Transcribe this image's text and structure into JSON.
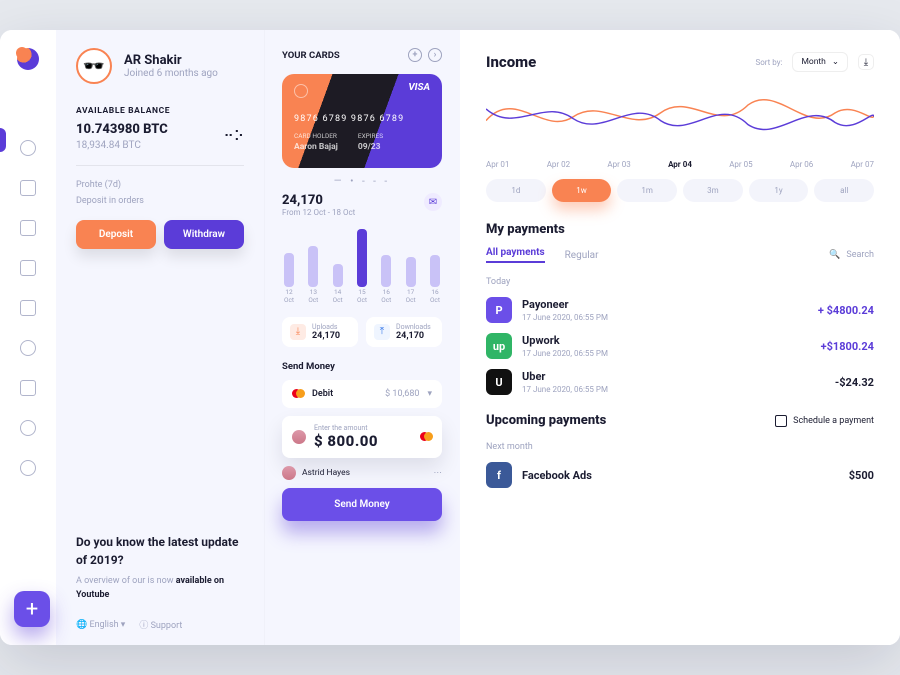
{
  "profile": {
    "name": "AR Shakir",
    "joined": "Joined 6 months ago",
    "balance_label": "AVAILABLE BALANCE",
    "balance_btc": "10.743980 BTC",
    "balance_alt": "18,934.84  BTC",
    "prohte": "Prohte (7d)",
    "deposit_in_orders": "Deposit in orders",
    "deposit_btn": "Deposit",
    "withdraw_btn": "Withdraw",
    "promo_title": "Do you know the latest update of 2019?",
    "promo_sub_a": "A overview of our is now ",
    "promo_sub_b": "available on Youtube",
    "lang": "English",
    "support": "Support"
  },
  "cards": {
    "title": "YOUR CARDS",
    "brand": "VISA",
    "number": "9876  6789  9876  6789",
    "holder_lbl": "CARD HOLDER",
    "holder": "Aaron Bajaj",
    "exp_lbl": "EXPIRES",
    "exp": "09/23",
    "stat_value": "24,170",
    "stat_range": "From 12 Oct - 18 Oct",
    "uploads_lbl": "Uploads",
    "uploads_val": "24,170",
    "downloads_lbl": "Downloads",
    "downloads_val": "24,170",
    "send_title": "Send Money",
    "debit": "Debit",
    "debit_amt": "$ 10,680",
    "enter_amt": "Enter the amount",
    "amount": "$ 800.00",
    "recipient": "Astrid Hayes",
    "send_btn": "Send Money"
  },
  "chart_data": {
    "bars": {
      "type": "bar",
      "categories": [
        "12 Oct",
        "13 Oct",
        "14 Oct",
        "15 Oct",
        "16 Oct",
        "17 Oct",
        "16 Oct"
      ],
      "values": [
        24,
        30,
        14,
        44,
        22,
        20,
        22
      ],
      "active_index": 3
    },
    "wave": {
      "type": "line",
      "x": [
        "Apr 01",
        "Apr 02",
        "Apr 03",
        "Apr 04",
        "Apr 05",
        "Apr 06",
        "Apr 07"
      ],
      "active_x_index": 3,
      "series": [
        {
          "name": "orange",
          "color": "#F98352",
          "values": [
            40,
            55,
            38,
            62,
            50,
            60,
            45
          ]
        },
        {
          "name": "purple",
          "color": "#5B3CD8",
          "values": [
            50,
            40,
            55,
            40,
            62,
            42,
            55
          ]
        }
      ],
      "ylim": [
        20,
        80
      ]
    }
  },
  "income": {
    "title": "Income",
    "sortby": "Sort by:",
    "sort_sel": "Month",
    "ranges": [
      "1d",
      "1w",
      "1m",
      "3m",
      "1y",
      "all"
    ],
    "range_active": 1,
    "my_payments": "My payments",
    "tab_all": "All payments",
    "tab_reg": "Regular",
    "search": "Search",
    "today": "Today",
    "rows": [
      {
        "icon": "P",
        "bg": "#6B4FE8",
        "name": "Payoneer",
        "date": "17 June 2020, 06:55 PM",
        "amt": "+ $4800.24",
        "cls": "pos"
      },
      {
        "icon": "up",
        "bg": "#30B566",
        "name": "Upwork",
        "date": "17 June 2020, 06:55 PM",
        "amt": "+$1800.24",
        "cls": "pos"
      },
      {
        "icon": "U",
        "bg": "#111",
        "name": "Uber",
        "date": "17 June 2020, 06:55 PM",
        "amt": "-$24.32",
        "cls": "neg"
      }
    ],
    "upcoming": "Upcoming payments",
    "schedule": "Schedule a payment",
    "next_month": "Next month",
    "next_rows": [
      {
        "icon": "f",
        "bg": "#3B5998",
        "name": "Facebook Ads",
        "amt": "$500"
      }
    ]
  }
}
